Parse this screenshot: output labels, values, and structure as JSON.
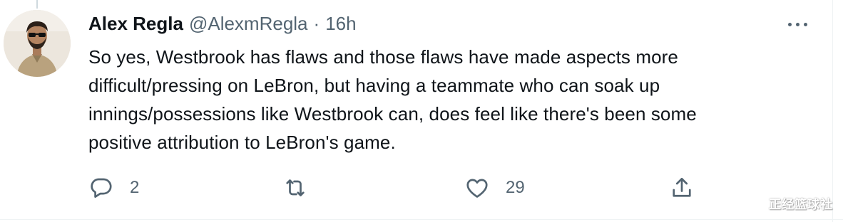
{
  "author": {
    "display_name": "Alex Regla",
    "handle": "@AlexmRegla",
    "separator": "·",
    "time": "16h"
  },
  "tweet": {
    "lines": [
      "So yes, Westbrook has flaws and those flaws have made aspects more",
      "difficult/pressing on LeBron, but having a teammate who can soak up",
      "innings/possessions like Westbrook can, does feel like there's been some",
      "positive attribution to LeBron's game."
    ]
  },
  "actions": {
    "reply_count": "2",
    "retweet_count": "",
    "like_count": "29"
  },
  "icons": {
    "more": "more-horizontal-icon",
    "reply": "reply-bubble-icon",
    "retweet": "retweet-icon",
    "like": "heart-icon",
    "share": "share-upload-icon"
  },
  "colors": {
    "text_primary": "#0f1419",
    "text_secondary": "#536471",
    "border": "#eff3f4"
  },
  "watermark": "正经篮球社"
}
